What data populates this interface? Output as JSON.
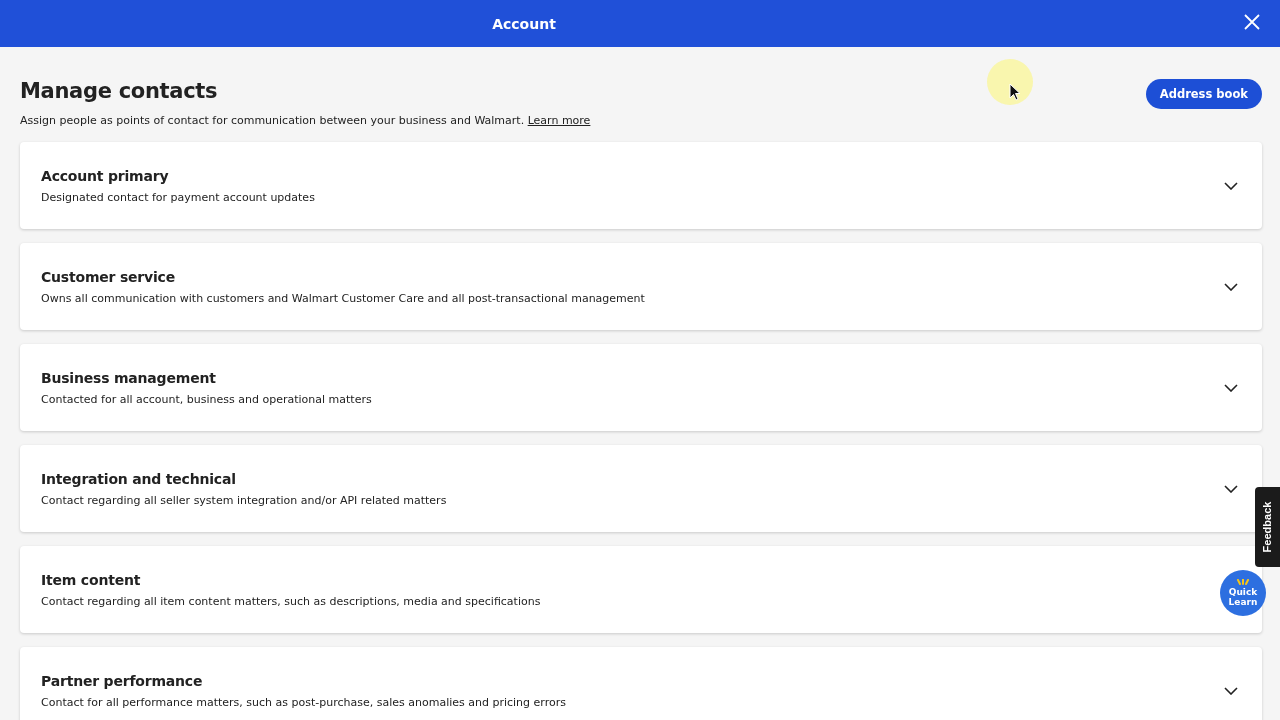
{
  "header": {
    "title": "Account"
  },
  "page": {
    "heading": "Manage contacts",
    "description": "Assign people as points of contact for communication between your business and Walmart.",
    "link": "Learn more",
    "button": "Address book"
  },
  "sections": [
    {
      "title": "Account primary",
      "subtitle": "Designated contact for payment account updates"
    },
    {
      "title": "Customer service",
      "subtitle": "Owns all communication with customers and Walmart Customer Care and all post-transactional management"
    },
    {
      "title": "Business management",
      "subtitle": "Contacted for all account, business and operational matters"
    },
    {
      "title": "Integration and technical",
      "subtitle": "Contact regarding all seller system integration and/or API related matters"
    },
    {
      "title": "Item content",
      "subtitle": "Contact regarding all item content matters, such as descriptions, media and specifications"
    },
    {
      "title": "Partner performance",
      "subtitle": "Contact for all performance matters, such as post-purchase, sales anomalies and pricing errors"
    }
  ],
  "feedback_tab": "Feedback",
  "quick_learn": [
    "Quick",
    "Learn"
  ]
}
